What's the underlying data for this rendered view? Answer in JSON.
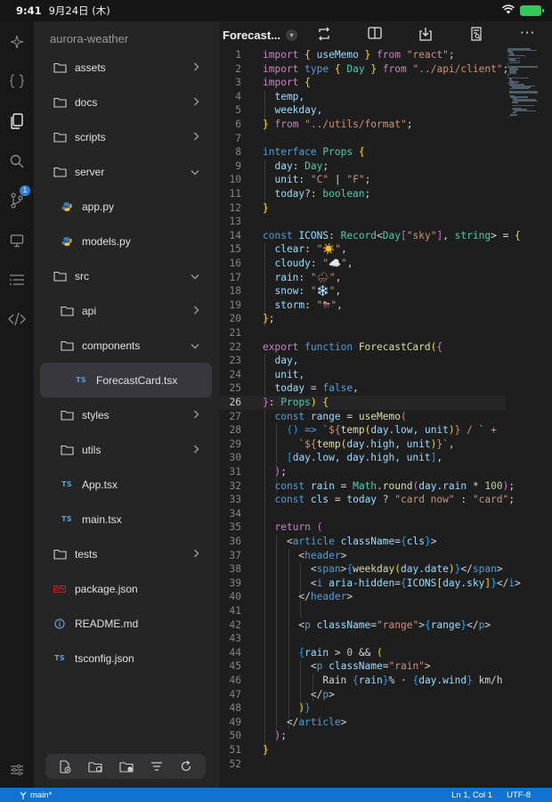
{
  "status": {
    "time": "9:41",
    "date": "9月24日 (木)"
  },
  "rail": {
    "scm_badge": "1"
  },
  "explorer": {
    "project": "aurora-weather",
    "items": [
      {
        "label": "assets",
        "kind": "folder",
        "depth": 0,
        "state": "collapsed"
      },
      {
        "label": "docs",
        "kind": "folder",
        "depth": 0,
        "state": "collapsed"
      },
      {
        "label": "scripts",
        "kind": "folder",
        "depth": 0,
        "state": "collapsed"
      },
      {
        "label": "server",
        "kind": "folder",
        "depth": 0,
        "state": "expanded"
      },
      {
        "label": "app.py",
        "kind": "python",
        "depth": 1
      },
      {
        "label": "models.py",
        "kind": "python",
        "depth": 1
      },
      {
        "label": "src",
        "kind": "folder",
        "depth": 0,
        "state": "expanded"
      },
      {
        "label": "api",
        "kind": "folder",
        "depth": 1,
        "state": "collapsed"
      },
      {
        "label": "components",
        "kind": "folder",
        "depth": 1,
        "state": "expanded"
      },
      {
        "label": "ForecastCard.tsx",
        "kind": "ts",
        "depth": 2,
        "selected": true
      },
      {
        "label": "styles",
        "kind": "folder",
        "depth": 1,
        "state": "collapsed"
      },
      {
        "label": "utils",
        "kind": "folder",
        "depth": 1,
        "state": "collapsed"
      },
      {
        "label": "App.tsx",
        "kind": "ts",
        "depth": 1
      },
      {
        "label": "main.tsx",
        "kind": "ts",
        "depth": 1
      },
      {
        "label": "tests",
        "kind": "folder",
        "depth": 0,
        "state": "collapsed"
      },
      {
        "label": "package.json",
        "kind": "npm",
        "depth": 0
      },
      {
        "label": "README.md",
        "kind": "info",
        "depth": 0
      },
      {
        "label": "tsconfig.json",
        "kind": "ts",
        "depth": 0
      }
    ],
    "ts_badge": "TS"
  },
  "editor": {
    "tab_title": "Forecast...",
    "cursor_line": 26,
    "lines": [
      [
        [
          "import",
          "ctl"
        ],
        [
          " ",
          "pl"
        ],
        [
          "{",
          "br1"
        ],
        [
          " useMemo ",
          "vr"
        ],
        [
          "}",
          "br1"
        ],
        [
          " ",
          "pl"
        ],
        [
          "from",
          "ctl"
        ],
        [
          " ",
          "pl"
        ],
        [
          "\"react\"",
          "str"
        ],
        [
          ";",
          "pl"
        ]
      ],
      [
        [
          "import",
          "ctl"
        ],
        [
          " ",
          "pl"
        ],
        [
          "type",
          "kw"
        ],
        [
          " ",
          "pl"
        ],
        [
          "{",
          "br1"
        ],
        [
          " Day ",
          "ty"
        ],
        [
          "}",
          "br1"
        ],
        [
          " ",
          "pl"
        ],
        [
          "from",
          "ctl"
        ],
        [
          " ",
          "pl"
        ],
        [
          "\"../api/client\"",
          "str"
        ],
        [
          ";",
          "pl"
        ]
      ],
      [
        [
          "import",
          "ctl"
        ],
        [
          " ",
          "pl"
        ],
        [
          "{",
          "br1"
        ]
      ],
      [
        [
          "  temp,",
          "vr"
        ]
      ],
      [
        [
          "  weekday,",
          "vr"
        ]
      ],
      [
        [
          "}",
          "br1"
        ],
        [
          " ",
          "pl"
        ],
        [
          "from",
          "ctl"
        ],
        [
          " ",
          "pl"
        ],
        [
          "\"../utils/format\"",
          "str"
        ],
        [
          ";",
          "pl"
        ]
      ],
      [],
      [
        [
          "interface",
          "kw"
        ],
        [
          " ",
          "pl"
        ],
        [
          "Props",
          "ty"
        ],
        [
          " ",
          "pl"
        ],
        [
          "{",
          "br1"
        ]
      ],
      [
        [
          "  day",
          "vr"
        ],
        [
          ": ",
          "pl"
        ],
        [
          "Day",
          "ty"
        ],
        [
          ";",
          "pl"
        ]
      ],
      [
        [
          "  unit",
          "vr"
        ],
        [
          ": ",
          "pl"
        ],
        [
          "\"C\"",
          "str"
        ],
        [
          " | ",
          "pl"
        ],
        [
          "\"F\"",
          "str"
        ],
        [
          ";",
          "pl"
        ]
      ],
      [
        [
          "  today",
          "vr"
        ],
        [
          "?: ",
          "pl"
        ],
        [
          "boolean",
          "ty"
        ],
        [
          ";",
          "pl"
        ]
      ],
      [
        [
          "}",
          "br1"
        ]
      ],
      [],
      [
        [
          "const",
          "kw"
        ],
        [
          " ",
          "pl"
        ],
        [
          "ICONS",
          "vr"
        ],
        [
          ": ",
          "pl"
        ],
        [
          "Record",
          "ty"
        ],
        [
          "<",
          "pl"
        ],
        [
          "Day",
          "ty"
        ],
        [
          "[",
          "br2"
        ],
        [
          "\"sky\"",
          "str"
        ],
        [
          "]",
          "br2"
        ],
        [
          ", ",
          "pl"
        ],
        [
          "string",
          "ty"
        ],
        [
          "> = ",
          "pl"
        ],
        [
          "{",
          "br1"
        ]
      ],
      [
        [
          "  clear",
          "vr"
        ],
        [
          ": ",
          "pl"
        ],
        [
          "\"☀️\"",
          "str"
        ],
        [
          ",",
          "pl"
        ]
      ],
      [
        [
          "  cloudy",
          "vr"
        ],
        [
          ": ",
          "pl"
        ],
        [
          "\"☁️\"",
          "str"
        ],
        [
          ",",
          "pl"
        ]
      ],
      [
        [
          "  rain",
          "vr"
        ],
        [
          ": ",
          "pl"
        ],
        [
          "\"🌧\"",
          "str"
        ],
        [
          ",",
          "pl"
        ]
      ],
      [
        [
          "  snow",
          "vr"
        ],
        [
          ": ",
          "pl"
        ],
        [
          "\"❄️\"",
          "str"
        ],
        [
          ",",
          "pl"
        ]
      ],
      [
        [
          "  storm",
          "vr"
        ],
        [
          ": ",
          "pl"
        ],
        [
          "\"⛈\"",
          "str"
        ],
        [
          ",",
          "pl"
        ]
      ],
      [
        [
          "}",
          "br1"
        ],
        [
          ";",
          "pl"
        ]
      ],
      [],
      [
        [
          "export",
          "ctl"
        ],
        [
          " ",
          "pl"
        ],
        [
          "function",
          "kw"
        ],
        [
          " ",
          "pl"
        ],
        [
          "ForecastCard",
          "fn"
        ],
        [
          "(",
          "br1"
        ],
        [
          "{",
          "br2"
        ]
      ],
      [
        [
          "  day,",
          "vr"
        ]
      ],
      [
        [
          "  unit,",
          "vr"
        ]
      ],
      [
        [
          "  today",
          "vr"
        ],
        [
          " = ",
          "pl"
        ],
        [
          "false",
          "kw"
        ],
        [
          ",",
          "pl"
        ]
      ],
      [
        [
          "}",
          "br2"
        ],
        [
          ": ",
          "pl"
        ],
        [
          "Props",
          "ty"
        ],
        [
          ")",
          "br1"
        ],
        [
          " ",
          "pl"
        ],
        [
          "{",
          "br1"
        ]
      ],
      [
        [
          "  ",
          "pl"
        ],
        [
          "const",
          "kw"
        ],
        [
          " ",
          "pl"
        ],
        [
          "range",
          "vr"
        ],
        [
          " = ",
          "pl"
        ],
        [
          "useMemo",
          "fn"
        ],
        [
          "(",
          "br2"
        ]
      ],
      [
        [
          "    ",
          "pl"
        ],
        [
          "()",
          "br3"
        ],
        [
          " ",
          "pl"
        ],
        [
          "=>",
          "kw"
        ],
        [
          " ",
          "pl"
        ],
        [
          "`${",
          "str"
        ],
        [
          "temp",
          "fn"
        ],
        [
          "(",
          "br1"
        ],
        [
          "day.low, unit",
          "vr"
        ],
        [
          ")",
          "br1"
        ],
        [
          "}",
          "str"
        ],
        [
          " / ` +",
          "str"
        ]
      ],
      [
        [
          "      `${",
          "str"
        ],
        [
          "temp",
          "fn"
        ],
        [
          "(",
          "br1"
        ],
        [
          "day.high, unit",
          "vr"
        ],
        [
          ")",
          "br1"
        ],
        [
          "}`",
          "str"
        ],
        [
          ",",
          "pl"
        ]
      ],
      [
        [
          "    ",
          "pl"
        ],
        [
          "[",
          "br3"
        ],
        [
          "day.low, day.high, unit",
          "vr"
        ],
        [
          "]",
          "br3"
        ],
        [
          ",",
          "pl"
        ]
      ],
      [
        [
          "  ",
          "pl"
        ],
        [
          ")",
          "br2"
        ],
        [
          ";",
          "pl"
        ]
      ],
      [
        [
          "  ",
          "pl"
        ],
        [
          "const",
          "kw"
        ],
        [
          " ",
          "pl"
        ],
        [
          "rain",
          "vr"
        ],
        [
          " = ",
          "pl"
        ],
        [
          "Math",
          "ty"
        ],
        [
          ".",
          "pl"
        ],
        [
          "round",
          "fn"
        ],
        [
          "(",
          "br2"
        ],
        [
          "day.rain",
          "vr"
        ],
        [
          " * ",
          "pl"
        ],
        [
          "100",
          "nm"
        ],
        [
          ")",
          "br2"
        ],
        [
          ";",
          "pl"
        ]
      ],
      [
        [
          "  ",
          "pl"
        ],
        [
          "const",
          "kw"
        ],
        [
          " ",
          "pl"
        ],
        [
          "cls",
          "vr"
        ],
        [
          " = ",
          "pl"
        ],
        [
          "today",
          "vr"
        ],
        [
          " ? ",
          "pl"
        ],
        [
          "\"card now\"",
          "str"
        ],
        [
          " : ",
          "pl"
        ],
        [
          "\"card\"",
          "str"
        ],
        [
          ";",
          "pl"
        ]
      ],
      [],
      [
        [
          "  ",
          "pl"
        ],
        [
          "return",
          "ctl"
        ],
        [
          " ",
          "pl"
        ],
        [
          "(",
          "br2"
        ]
      ],
      [
        [
          "    <",
          "pl"
        ],
        [
          "article",
          "tg"
        ],
        [
          " ",
          "pl"
        ],
        [
          "className",
          "at"
        ],
        [
          "=",
          "pl"
        ],
        [
          "{",
          "br3"
        ],
        [
          "cls",
          "vr"
        ],
        [
          "}",
          "br3"
        ],
        [
          ">",
          "pl"
        ]
      ],
      [
        [
          "      <",
          "pl"
        ],
        [
          "header",
          "tg"
        ],
        [
          ">",
          "pl"
        ]
      ],
      [
        [
          "        <",
          "pl"
        ],
        [
          "span",
          "tg"
        ],
        [
          ">",
          "pl"
        ],
        [
          "{",
          "br3"
        ],
        [
          "weekday",
          "fn"
        ],
        [
          "(",
          "br1"
        ],
        [
          "day.date",
          "vr"
        ],
        [
          ")",
          "br1"
        ],
        [
          "}",
          "br3"
        ],
        [
          "</",
          "pl"
        ],
        [
          "span",
          "tg"
        ],
        [
          ">",
          "pl"
        ]
      ],
      [
        [
          "        <",
          "pl"
        ],
        [
          "i",
          "tg"
        ],
        [
          " ",
          "pl"
        ],
        [
          "aria-hidden",
          "at"
        ],
        [
          "=",
          "pl"
        ],
        [
          "{",
          "br3"
        ],
        [
          "ICONS",
          "vr"
        ],
        [
          "[",
          "br1"
        ],
        [
          "day.sky",
          "vr"
        ],
        [
          "]",
          "br1"
        ],
        [
          "}",
          "br3"
        ],
        [
          "</",
          "pl"
        ],
        [
          "i",
          "tg"
        ],
        [
          ">",
          "pl"
        ]
      ],
      [
        [
          "      </",
          "pl"
        ],
        [
          "header",
          "tg"
        ],
        [
          ">",
          "pl"
        ]
      ],
      [],
      [
        [
          "      <",
          "pl"
        ],
        [
          "p",
          "tg"
        ],
        [
          " ",
          "pl"
        ],
        [
          "className",
          "at"
        ],
        [
          "=",
          "pl"
        ],
        [
          "\"range\"",
          "str"
        ],
        [
          ">",
          "pl"
        ],
        [
          "{",
          "br3"
        ],
        [
          "range",
          "vr"
        ],
        [
          "}",
          "br3"
        ],
        [
          "</",
          "pl"
        ],
        [
          "p",
          "tg"
        ],
        [
          ">",
          "pl"
        ]
      ],
      [],
      [
        [
          "      ",
          "pl"
        ],
        [
          "{",
          "br3"
        ],
        [
          "rain",
          "vr"
        ],
        [
          " > ",
          "pl"
        ],
        [
          "0",
          "nm"
        ],
        [
          " && ",
          "pl"
        ],
        [
          "(",
          "br1"
        ]
      ],
      [
        [
          "        <",
          "pl"
        ],
        [
          "p",
          "tg"
        ],
        [
          " ",
          "pl"
        ],
        [
          "className",
          "at"
        ],
        [
          "=",
          "pl"
        ],
        [
          "\"rain\"",
          "str"
        ],
        [
          ">",
          "pl"
        ]
      ],
      [
        [
          "          Rain ",
          "pl"
        ],
        [
          "{",
          "br3"
        ],
        [
          "rain",
          "vr"
        ],
        [
          "}",
          "br3"
        ],
        [
          "% · ",
          "pl"
        ],
        [
          "{",
          "br3"
        ],
        [
          "day.wind",
          "vr"
        ],
        [
          "}",
          "br3"
        ],
        [
          " km/h",
          "pl"
        ]
      ],
      [
        [
          "        </",
          "pl"
        ],
        [
          "p",
          "tg"
        ],
        [
          ">",
          "pl"
        ]
      ],
      [
        [
          "      ",
          "pl"
        ],
        [
          ")",
          "br1"
        ],
        [
          "}",
          "br3"
        ]
      ],
      [
        [
          "    </",
          "pl"
        ],
        [
          "article",
          "tg"
        ],
        [
          ">",
          "pl"
        ]
      ],
      [
        [
          "  ",
          "pl"
        ],
        [
          ")",
          "br2"
        ],
        [
          ";",
          "pl"
        ]
      ],
      [
        [
          "}",
          "br1"
        ]
      ],
      []
    ]
  },
  "footer": {
    "branch": "main*",
    "position": "Ln 1, Col 1",
    "encoding": "UTF-8"
  },
  "colors": {
    "accent": "#1073cf",
    "selection": "#37373d"
  }
}
